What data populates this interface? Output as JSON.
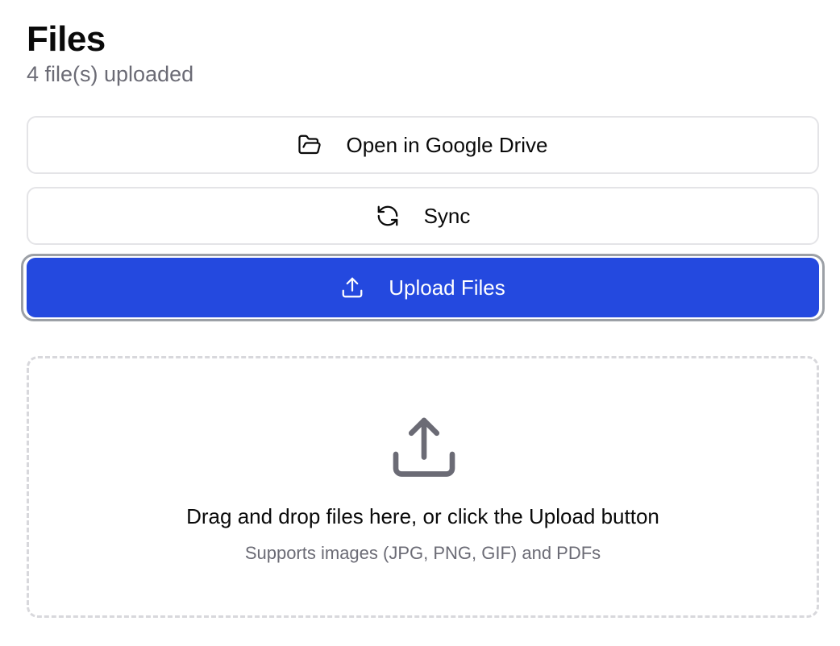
{
  "header": {
    "title": "Files",
    "subtitle": "4 file(s) uploaded"
  },
  "actions": {
    "open_drive": {
      "label": "Open in Google Drive",
      "icon": "folder-open-icon"
    },
    "sync": {
      "label": "Sync",
      "icon": "refresh-icon"
    },
    "upload": {
      "label": "Upload Files",
      "icon": "upload-icon"
    }
  },
  "dropzone": {
    "icon": "upload-icon",
    "title": "Drag and drop files here, or click the Upload button",
    "subtitle": "Supports images (JPG, PNG, GIF) and PDFs"
  },
  "colors": {
    "primary": "#2449df",
    "muted_text": "#6b6b75",
    "border": "#e4e4e7",
    "dropzone_border": "#d8d8dc"
  }
}
